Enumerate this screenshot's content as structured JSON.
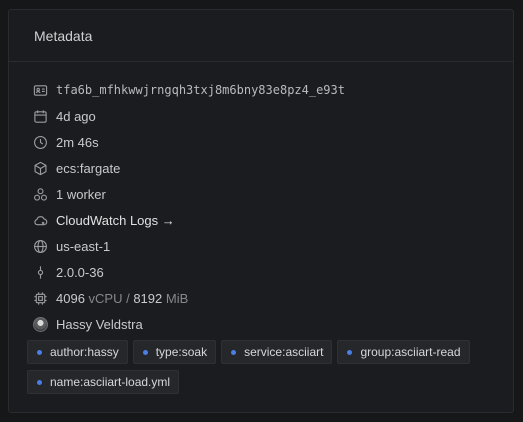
{
  "panel": {
    "title": "Metadata"
  },
  "rows": {
    "id": {
      "icon": "id-card-icon",
      "text": "tfa6b_mfhkwwjrngqh3txj8m6bny83e8pz4_e93t"
    },
    "date": {
      "icon": "calendar-icon",
      "text": "4d ago"
    },
    "duration": {
      "icon": "clock-icon",
      "text": "2m 46s"
    },
    "platform": {
      "icon": "cube-icon",
      "text": "ecs:fargate"
    },
    "workers": {
      "icon": "workers-icon",
      "text": "1 worker"
    },
    "logs": {
      "icon": "cloud-icon",
      "text": "CloudWatch Logs →"
    },
    "region": {
      "icon": "globe-icon",
      "text": "us-east-1"
    },
    "version": {
      "icon": "commit-icon",
      "text": "2.0.0-36"
    },
    "resources": {
      "icon": "cpu-icon",
      "cpu": "4096",
      "cpu_unit": " vCPU / ",
      "mem": "8192",
      "mem_unit": " MiB"
    },
    "user": {
      "icon": "avatar",
      "text": "Hassy Veldstra"
    }
  },
  "tags": [
    "author:hassy",
    "type:soak",
    "service:asciiart",
    "group:asciiart-read",
    "name:asciiart-load.yml"
  ],
  "colors": {
    "background": "#161719",
    "panel": "#1b1c1f",
    "tag_dot": "#4a7ee6"
  }
}
